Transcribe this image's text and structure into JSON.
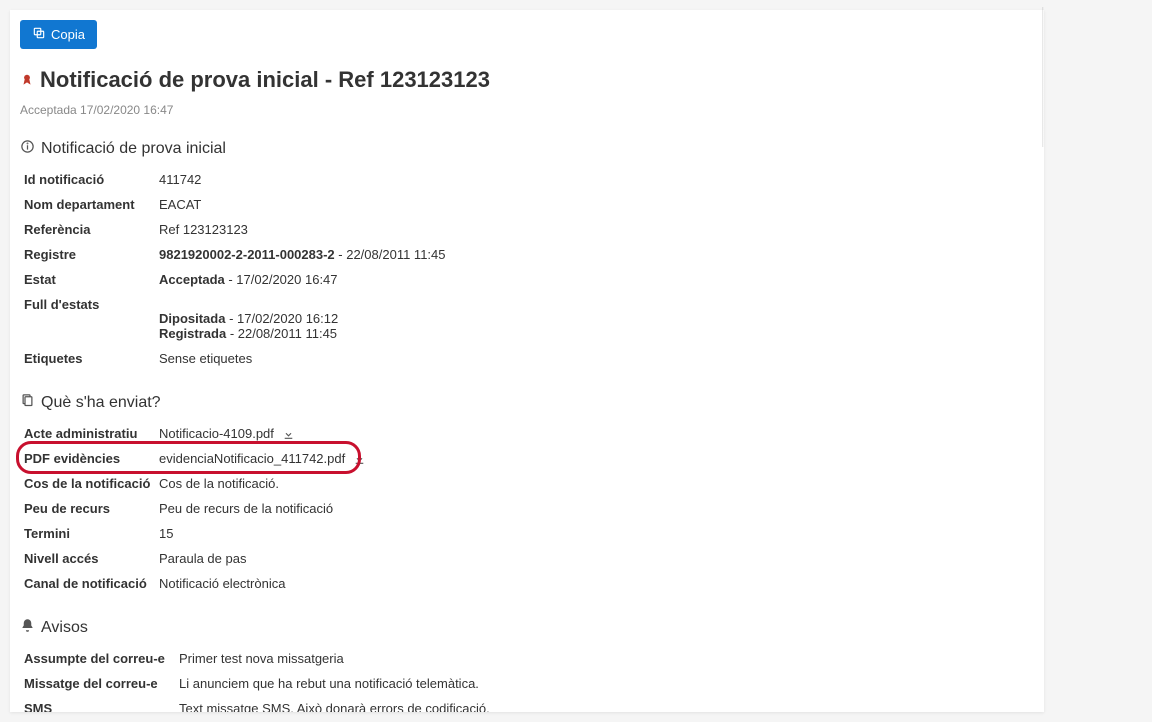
{
  "header": {
    "copy_label": "Copia"
  },
  "title": "Notificació de prova inicial - Ref 123123123",
  "status": "Acceptada 17/02/2020 16:47",
  "section_info": {
    "heading": "Notificació de prova inicial",
    "id_label": "Id notificació",
    "id_value": "411742",
    "dept_label": "Nom departament",
    "dept_value": "EACAT",
    "ref_label": "Referència",
    "ref_value": "Ref 123123123",
    "reg_label": "Registre",
    "reg_bold": "9821920002-2-2011-000283-2",
    "reg_rest": " - 22/08/2011 11:45",
    "estat_label": "Estat",
    "estat_bold": "Acceptada",
    "estat_rest": " - 17/02/2020 16:47",
    "full_label": "Full d'estats",
    "full_line1_bold": "Dipositada",
    "full_line1_rest": " - 17/02/2020 16:12",
    "full_line2_bold": "Registrada",
    "full_line2_rest": " - 22/08/2011 11:45",
    "etiq_label": "Etiquetes",
    "etiq_value": "Sense etiquetes"
  },
  "section_sent": {
    "heading": "Què s'ha enviat?",
    "acte_label": "Acte administratiu",
    "acte_value": "Notificacio-4109.pdf",
    "pdf_label": "PDF evidències",
    "pdf_value": "evidenciaNotificacio_411742.pdf",
    "cos_label": "Cos de la notificació",
    "cos_value": "Cos de la notificació.",
    "peu_label": "Peu de recurs",
    "peu_value": "Peu de recurs de la notificació",
    "termini_label": "Termini",
    "termini_value": "15",
    "nivell_label": "Nivell accés",
    "nivell_value": "Paraula de pas",
    "canal_label": "Canal de notificació",
    "canal_value": "Notificació electrònica"
  },
  "section_avisos": {
    "heading": "Avisos",
    "assumpte_label": "Assumpte del correu-e",
    "assumpte_value": "Primer test nova missatgeria",
    "missatge_label": "Missatge del correu-e",
    "missatge_value": "Li anunciem que ha rebut una notificació telemàtica.",
    "sms_label": "SMS",
    "sms_value": "Text missatge SMS. Això donarà errors de codificació."
  }
}
